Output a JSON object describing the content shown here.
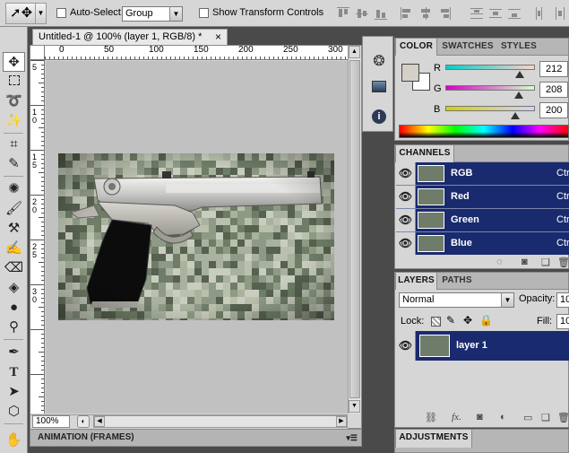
{
  "options_bar": {
    "auto_select_label": "Auto-Select:",
    "auto_select_value": "Group",
    "show_transform_label": "Show Transform Controls"
  },
  "document": {
    "tab_title": "Untitled-1 @ 100% (layer 1, RGB/8) *",
    "close_glyph": "×",
    "ruler_h": [
      "0",
      "50",
      "100",
      "150",
      "200",
      "250",
      "300"
    ],
    "ruler_v": [
      "5",
      "10",
      "15",
      "20",
      "25",
      "30"
    ],
    "zoom": "100%"
  },
  "animation_panel": {
    "title": "ANIMATION (FRAMES)"
  },
  "color_panel": {
    "tabs": [
      "COLOR",
      "SWATCHES",
      "STYLES"
    ],
    "channels": [
      {
        "label": "R",
        "value": "212",
        "fraction": 0.831
      },
      {
        "label": "G",
        "value": "208",
        "fraction": 0.816
      },
      {
        "label": "B",
        "value": "200",
        "fraction": 0.784
      }
    ],
    "foreground_color": "#d4d0c8",
    "background_color": "#ffffff"
  },
  "channels_panel": {
    "tab": "CHANNELS",
    "rows": [
      {
        "name": "RGB",
        "shortcut": "Ctr"
      },
      {
        "name": "Red",
        "shortcut": "Ctr"
      },
      {
        "name": "Green",
        "shortcut": "Ctr"
      },
      {
        "name": "Blue",
        "shortcut": "Ctr"
      }
    ]
  },
  "layers_panel": {
    "tabs": [
      "LAYERS",
      "PATHS"
    ],
    "blend_mode": "Normal",
    "opacity_label": "Opacity:",
    "opacity_value": "10",
    "lock_label": "Lock:",
    "fill_label": "Fill:",
    "fill_value": "10",
    "layers": [
      {
        "name": "layer 1"
      }
    ]
  },
  "adjustments_panel": {
    "title": "ADJUSTMENTS"
  },
  "colors": {
    "selection_blue": "#1a2a6e",
    "ui_gray": "#d6d6d6",
    "canvas_gray": "#c1c1c1"
  }
}
